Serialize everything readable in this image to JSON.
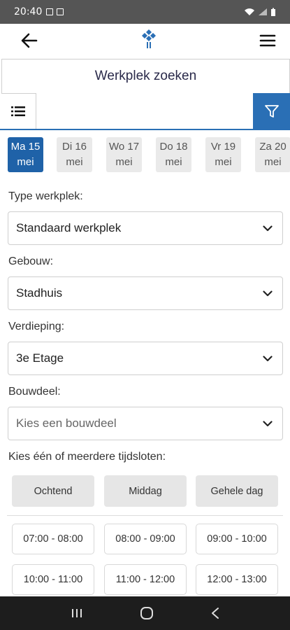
{
  "status_bar": {
    "time": "20:40"
  },
  "header": {
    "back_icon": "arrow-left-icon",
    "logo_icon": "brand-logo-icon",
    "menu_icon": "hamburger-menu-icon",
    "brand_color": "#2a6fb5"
  },
  "title": "Werkplek zoeken",
  "search": {
    "value": "",
    "placeholder": ""
  },
  "dates": [
    {
      "day": "Ma 15",
      "month": "mei",
      "active": true
    },
    {
      "day": "Di 16",
      "month": "mei",
      "active": false
    },
    {
      "day": "Wo 17",
      "month": "mei",
      "active": false
    },
    {
      "day": "Do 18",
      "month": "mei",
      "active": false
    },
    {
      "day": "Vr 19",
      "month": "mei",
      "active": false
    },
    {
      "day": "Za 20",
      "month": "mei",
      "active": false
    }
  ],
  "form": {
    "type_label": "Type werkplek:",
    "type_value": "Standaard werkplek",
    "building_label": "Gebouw:",
    "building_value": "Stadhuis",
    "floor_label": "Verdieping:",
    "floor_value": "3e Etage",
    "section_label": "Bouwdeel:",
    "section_placeholder": "Kies een bouwdeel",
    "timeslot_label": "Kies één of meerdere tijdsloten:"
  },
  "periods": [
    "Ochtend",
    "Middag",
    "Gehele dag"
  ],
  "slots": [
    "07:00 - 08:00",
    "08:00 - 09:00",
    "09:00 - 10:00",
    "10:00 - 11:00",
    "11:00 - 12:00",
    "12:00 - 13:00"
  ]
}
